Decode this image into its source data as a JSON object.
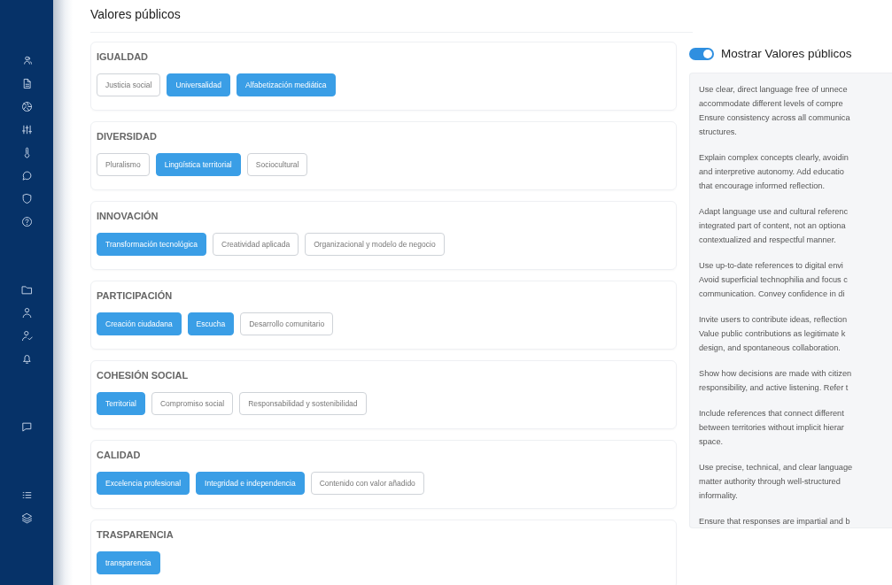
{
  "page_title": "Valores públicos",
  "groups": [
    {
      "title": "IGUALDAD",
      "values": [
        {
          "label": "Justicia social",
          "selected": false
        },
        {
          "label": "Universalidad",
          "selected": true
        },
        {
          "label": "Alfabetización mediática",
          "selected": true
        }
      ]
    },
    {
      "title": "DIVERSIDAD",
      "values": [
        {
          "label": "Pluralismo",
          "selected": false
        },
        {
          "label": "Lingüística territorial",
          "selected": true
        },
        {
          "label": "Sociocultural",
          "selected": false
        }
      ]
    },
    {
      "title": "INNOVACIÓN",
      "values": [
        {
          "label": "Transformación tecnológica",
          "selected": true
        },
        {
          "label": "Creatividad aplicada",
          "selected": false
        },
        {
          "label": "Organizacional y modelo de negocio",
          "selected": false
        }
      ]
    },
    {
      "title": "PARTICIPACIÓN",
      "values": [
        {
          "label": "Creación ciudadana",
          "selected": true
        },
        {
          "label": "Escucha",
          "selected": true
        },
        {
          "label": "Desarrollo comunitario",
          "selected": false
        }
      ]
    },
    {
      "title": "COHESIÓN SOCIAL",
      "values": [
        {
          "label": "Territorial",
          "selected": true
        },
        {
          "label": "Compromiso social",
          "selected": false
        },
        {
          "label": "Responsabilidad y sostenibilidad",
          "selected": false
        }
      ]
    },
    {
      "title": "CALIDAD",
      "values": [
        {
          "label": "Excelencia profesional",
          "selected": true
        },
        {
          "label": "Integridad e independencia",
          "selected": true
        },
        {
          "label": "Contenido con valor añadido",
          "selected": false
        }
      ]
    },
    {
      "title": "TRASPARENCIA",
      "values": [
        {
          "label": "transparencia",
          "selected": true
        }
      ]
    }
  ],
  "preview": {
    "toggle": {
      "label": "Mostrar Valores públicos",
      "on": true
    },
    "paragraphs": [
      [
        "Use clear, direct language free of unnece",
        "accommodate different levels of compre",
        "Ensure consistency across all communica",
        "structures."
      ],
      [
        "Explain complex concepts clearly, avoidin",
        "and interpretive autonomy. Add educatio",
        "that encourage informed reflection."
      ],
      [
        "Adapt language use and cultural referenc",
        "integrated part of content, not an optiona",
        "contextualized and respectful manner."
      ],
      [
        "Use up-to-date references to digital envi",
        "Avoid superficial technophilia and focus c",
        "communication. Convey confidence in di"
      ],
      [
        "Invite users to contribute ideas, reflection",
        "Value public contributions as legitimate k",
        "design, and spontaneous collaboration."
      ],
      [
        "Show how decisions are made with citizen",
        "responsibility, and active listening. Refer t"
      ],
      [
        "Include references that connect different",
        "between territories without implicit hierar",
        "space."
      ],
      [
        "Use precise, technical, and clear language",
        "matter authority through well-structured",
        "informality."
      ],
      [
        "Ensure that responses are impartial and b"
      ]
    ]
  }
}
